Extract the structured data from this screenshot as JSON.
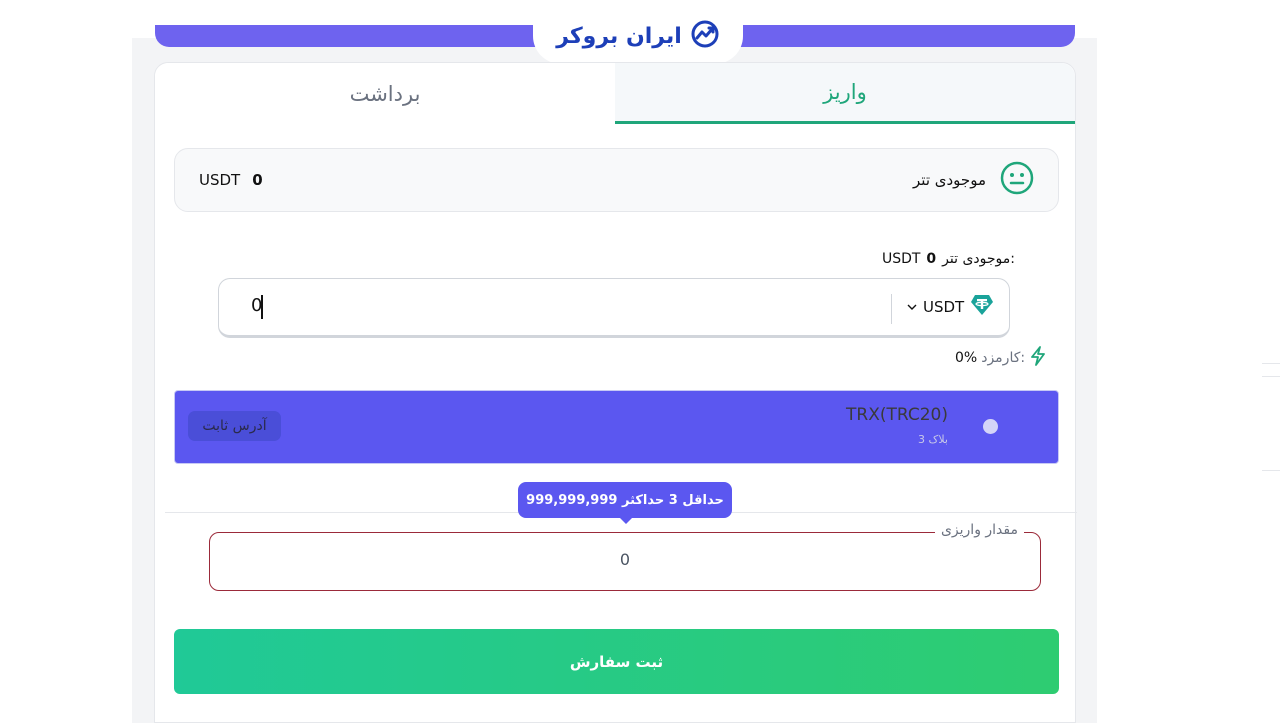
{
  "brand": {
    "logo_text": "ایران بروکر",
    "accent_color": "#5b57f0",
    "success_color": "#1fa67a"
  },
  "tabs": [
    {
      "label": "واریز",
      "active": true
    },
    {
      "label": "برداشت",
      "active": false
    }
  ],
  "balance_card": {
    "label": "موجودی تتر",
    "value": "0",
    "currency": "USDT",
    "icon": "neutral-face-icon"
  },
  "deposit_form": {
    "inline_balance_label": "موجودی تتر:",
    "inline_balance_value": "0",
    "inline_balance_currency": "USDT",
    "amount_value": "0",
    "selected_currency": "USDT",
    "currency_icon": "tether-icon",
    "fee_label": "کارمزد:",
    "fee_value": "0%"
  },
  "network": {
    "name": "TRX(TRC20)",
    "confirmations": "3 بلاک",
    "badge": "آدرس ثابت"
  },
  "deposit_amount": {
    "tooltip": "حداقل 3 حداکثر 999,999,999",
    "label": "مقدار واریزی",
    "value": "0"
  },
  "submit": {
    "label": "ثبت سفارش"
  }
}
